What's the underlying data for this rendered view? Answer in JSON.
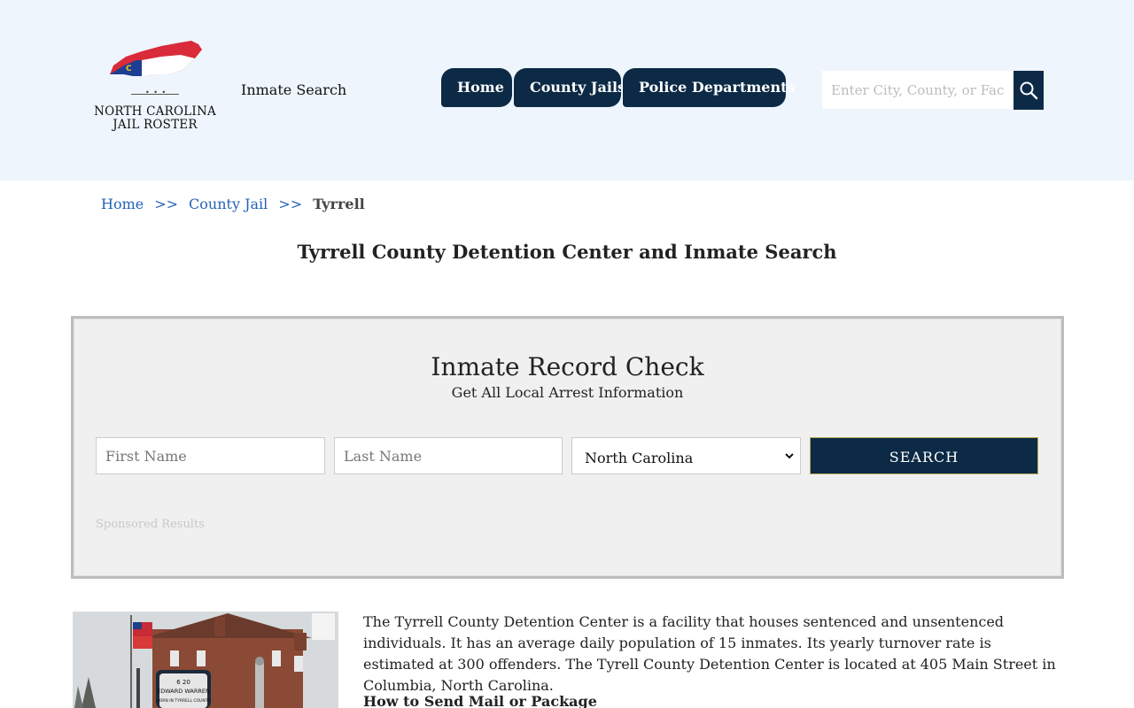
{
  "header": {
    "logo_text_line1": "NORTH CAROLINA",
    "logo_text_line2": "JAIL ROSTER",
    "logo_dots": "• • •",
    "inmate_search_link": "Inmate Search",
    "nav": [
      {
        "label": "Home"
      },
      {
        "label": "County Jails"
      },
      {
        "label": "Police Departments"
      }
    ],
    "search_placeholder": "Enter City, County, or Facility"
  },
  "breadcrumb": {
    "home": "Home",
    "county_jail": "County Jail",
    "separator": ">>",
    "current": "Tyrrell"
  },
  "page_title": "Tyrrell County Detention Center and Inmate Search",
  "record_check": {
    "title": "Inmate Record Check",
    "subtitle": "Get All Local Arrest Information",
    "first_name_placeholder": "First Name",
    "last_name_placeholder": "Last Name",
    "state_value": "North Carolina",
    "search_label": "SEARCH",
    "sponsored": "Sponsored Results"
  },
  "content": {
    "intro": "The Tyrrell County Detention Center is a facility that houses sentenced and unsentenced individuals. It has an average daily population of 15 inmates. Its yearly turnover rate is estimated at 300 offenders. The Tyrell County Detention Center is located at 405 Main Street in Columbia, North Carolina.",
    "subhead": "How to Send Mail or Package",
    "photo_sign_line1": "6  20",
    "photo_sign_line2": "EDWARD WARREN",
    "photo_sign_line3": "BORN IN TYRRELL COUNTY"
  },
  "colors": {
    "navy": "#0c2a45",
    "header_bg": "#eef5fd",
    "link_blue": "#2463b8",
    "panel_bg": "#f0f0f0"
  }
}
